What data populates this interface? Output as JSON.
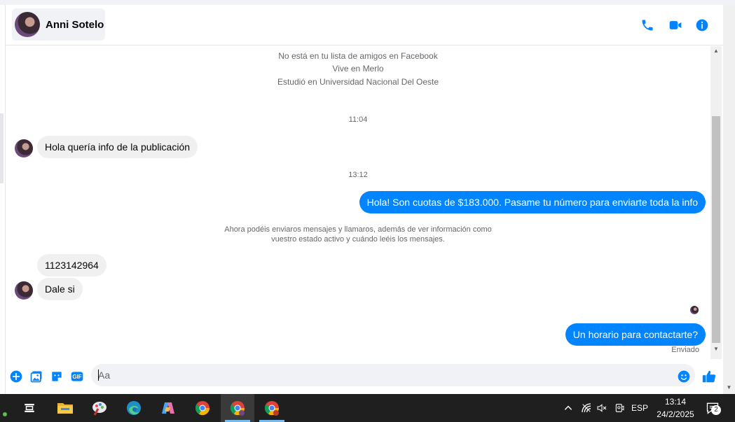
{
  "header": {
    "contact_name": "Anni Sotelo",
    "icons": [
      "phone-icon",
      "video-icon",
      "info-icon"
    ]
  },
  "profile_info": {
    "line1": "No está en tu lista de amigos en Facebook",
    "line2": "Vive en Merlo",
    "line3": "Estudió en Universidad Nacional Del Oeste"
  },
  "messages": {
    "time1": "11:04",
    "msg1": "Hola quería info de la publicación",
    "time2": "13:12",
    "msg2": "Hola! Son cuotas de $183.000. Pasame tu número para enviarte toda la info",
    "system_line1": "Ahora podéis enviaros mensajes y llamaros, además de ver información como",
    "system_line2": "vuestro estado activo y cuándo leéis los mensajes.",
    "msg3": "1123142964",
    "msg4": "Dale si",
    "msg5": "Un horario para contactarte?",
    "sent_status": "Enviado"
  },
  "composer": {
    "placeholder": "Aa",
    "gif_label": "GIF"
  },
  "taskbar": {
    "lang": "ESP",
    "time": "13:14",
    "date": "24/2/2025",
    "notification_count": "2"
  },
  "colors": {
    "accent": "#0084ff",
    "incoming_bubble": "#f0f0f0"
  }
}
